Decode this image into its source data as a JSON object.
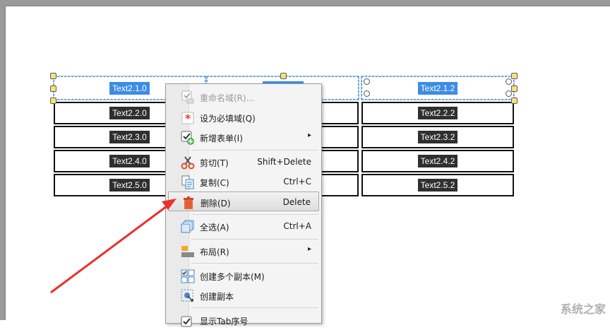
{
  "table": {
    "rows": [
      [
        "Text2.1.0",
        "",
        "Text2.1.2"
      ],
      [
        "Text2.2.0",
        "",
        "Text2.2.2"
      ],
      [
        "Text2.3.0",
        "",
        "Text2.3.2"
      ],
      [
        "Text2.4.0",
        "",
        "Text2.4.2"
      ],
      [
        "Text2.5.0",
        "",
        "Text2.5.2"
      ]
    ]
  },
  "menu": {
    "items": [
      {
        "label": "重命名域(R)...",
        "shortcut": "",
        "icon": "rename-field-icon",
        "disabled": true
      },
      {
        "label": "设为必填域(Q)",
        "shortcut": "",
        "icon": "required-field-icon"
      },
      {
        "label": "新增表单(I)",
        "shortcut": "",
        "icon": "new-form-icon",
        "submenu": true
      },
      {
        "label": "剪切(T)",
        "shortcut": "Shift+Delete",
        "icon": "scissors-icon"
      },
      {
        "label": "复制(C)",
        "shortcut": "Ctrl+C",
        "icon": "copy-icon"
      },
      {
        "label": "删除(D)",
        "shortcut": "Delete",
        "icon": "trash-icon",
        "highlighted": true
      },
      {
        "label": "全选(A)",
        "shortcut": "Ctrl+A",
        "icon": "select-all-icon"
      },
      {
        "label": "布局(R)",
        "shortcut": "",
        "icon": "layout-icon",
        "submenu": true
      },
      {
        "label": "创建多个副本(M)",
        "shortcut": "",
        "icon": "multiple-copies-icon"
      },
      {
        "label": "创建副本",
        "shortcut": "",
        "icon": "create-copy-icon"
      },
      {
        "label": "显示Tab序号",
        "shortcut": "",
        "icon": "tab-order-icon"
      }
    ],
    "submenu_arrow": "▸"
  },
  "watermark": "系统之家",
  "colors": {
    "selection": "#3c8ce6",
    "handle": "#f7e17b",
    "arrow": "#e8322b",
    "delete_icon": "#e8663a"
  }
}
